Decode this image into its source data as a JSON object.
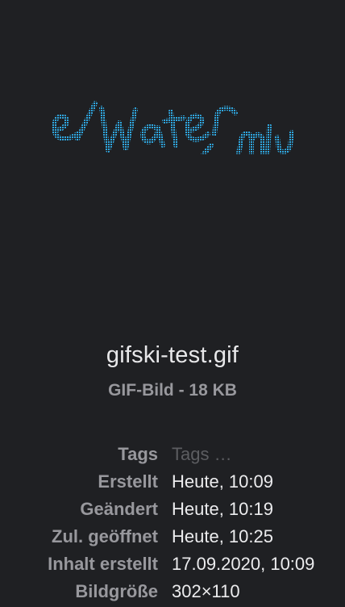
{
  "file": {
    "name": "gifski-test.gif",
    "kind": "GIF-Bild - 18 KB"
  },
  "preview": {
    "icon": "gif-preview-image",
    "accent": "#2fa7e0"
  },
  "metadata": [
    {
      "label": "Tags",
      "value": "Tags …",
      "placeholder": true
    },
    {
      "label": "Erstellt",
      "value": "Heute, 10:09"
    },
    {
      "label": "Geändert",
      "value": "Heute, 10:19"
    },
    {
      "label": "Zul. geöffnet",
      "value": "Heute, 10:25"
    },
    {
      "label": "Inhalt erstellt",
      "value": "17.09.2020, 10:09"
    },
    {
      "label": "Bildgröße",
      "value": "302×110"
    }
  ]
}
